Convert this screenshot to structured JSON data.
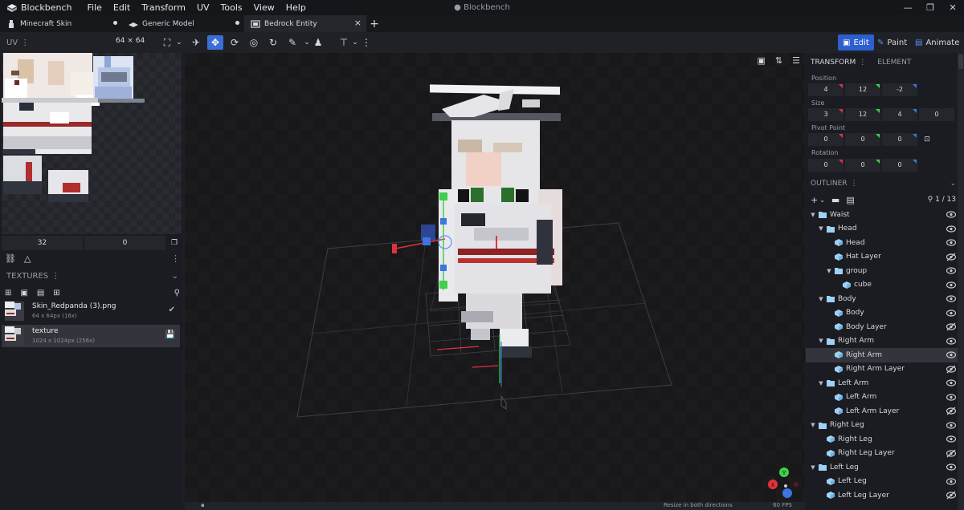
{
  "app": {
    "name": "Blockbench",
    "window_title": "Blockbench",
    "menu": [
      "File",
      "Edit",
      "Transform",
      "UV",
      "Tools",
      "View",
      "Help"
    ]
  },
  "tabs": [
    {
      "label": "Minecraft Skin"
    },
    {
      "label": "Generic Model"
    },
    {
      "label": "Bedrock Entity"
    }
  ],
  "toolbar": {
    "uv_label": "UV",
    "uv_size": "64 × 64",
    "modes": {
      "edit": "Edit",
      "paint": "Paint",
      "animate": "Animate"
    }
  },
  "uv": {
    "field_a": "32",
    "field_b": "0"
  },
  "textures": {
    "header": "TEXTURES",
    "items": [
      {
        "name": "Skin_Redpanda (3).png",
        "info": "64 x 64px (16x)"
      },
      {
        "name": "texture",
        "info": "1024 x 1024px (256x)"
      }
    ]
  },
  "properties": {
    "tabs": {
      "transform": "TRANSFORM",
      "element": "ELEMENT"
    },
    "position": {
      "label": "Position",
      "values": [
        "4",
        "12",
        "-2"
      ]
    },
    "size": {
      "label": "Size",
      "values": [
        "3",
        "12",
        "4",
        "0"
      ]
    },
    "pivot": {
      "label": "Pivot Point",
      "values": [
        "0",
        "0",
        "0"
      ]
    },
    "rotation": {
      "label": "Rotation",
      "values": [
        "0",
        "0",
        "0"
      ]
    }
  },
  "outliner": {
    "header": "OUTLINER",
    "count": "1 / 13",
    "items": [
      {
        "label": "Waist"
      },
      {
        "label": "Head"
      },
      {
        "label": "Head"
      },
      {
        "label": "Hat Layer"
      },
      {
        "label": "group"
      },
      {
        "label": "cube"
      },
      {
        "label": "Body"
      },
      {
        "label": "Body"
      },
      {
        "label": "Body Layer"
      },
      {
        "label": "Right Arm"
      },
      {
        "label": "Right Arm"
      },
      {
        "label": "Right Arm Layer"
      },
      {
        "label": "Left Arm"
      },
      {
        "label": "Left Arm"
      },
      {
        "label": "Left Arm Layer"
      },
      {
        "label": "Right Leg"
      },
      {
        "label": "Right Leg"
      },
      {
        "label": "Right Leg Layer"
      },
      {
        "label": "Left Leg"
      },
      {
        "label": "Left Leg"
      },
      {
        "label": "Left Leg Layer"
      }
    ]
  },
  "status": {
    "hint": "Resize in both directions",
    "fps": "60 FPS"
  },
  "colors": {
    "accent": "#2d5fd0",
    "axis_x": "#e0323c",
    "axis_y": "#3fd04a",
    "axis_z": "#3c74e0",
    "folder": "#9fd0f5"
  }
}
